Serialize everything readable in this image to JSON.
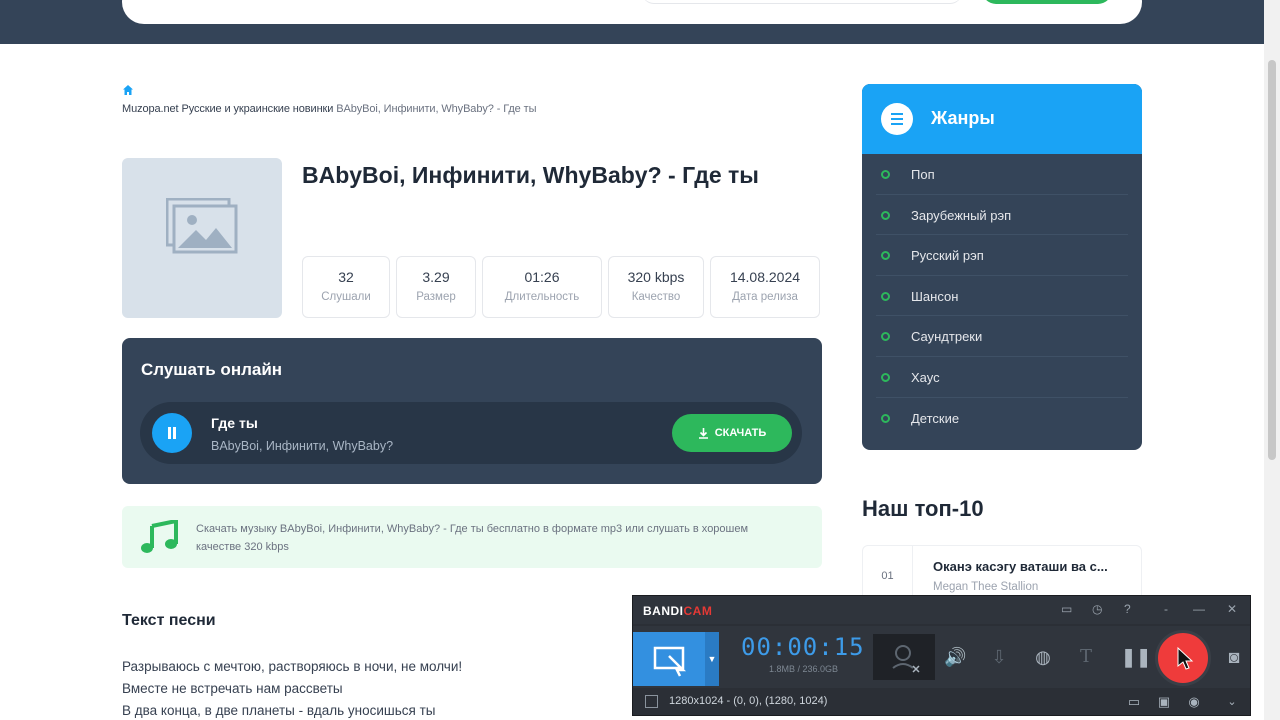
{
  "breadcrumb": {
    "site": "Muzopa.net",
    "category": "Русские и украинские новинки",
    "current": "BAbyBoi, Инфинити, WhyBaby? - Где ты"
  },
  "track": {
    "title": "BAbyBoi, Инфинити, WhyBaby? - Где ты",
    "stats": [
      {
        "value": "32",
        "label": "Слушали"
      },
      {
        "value": "3.29",
        "label": "Размер"
      },
      {
        "value": "01:26",
        "label": "Длительность"
      },
      {
        "value": "320 kbps",
        "label": "Качество"
      },
      {
        "value": "14.08.2024",
        "label": "Дата релиза"
      }
    ]
  },
  "player": {
    "heading": "Слушать онлайн",
    "song": "Где ты",
    "artist": "BAbyBoi, Инфинити, WhyBaby?",
    "download_label": "СКАЧАТЬ"
  },
  "info": {
    "text": "Скачать музыку BAbyBoi, Инфинити, WhyBaby? - Где ты бесплатно в формате mp3 или слушать в хорошем качестве 320 kbps"
  },
  "lyrics": {
    "heading": "Текст песни",
    "lines": [
      "Разрываюсь с мечтою, растворяюсь в ночи, не молчи!",
      "Вместе не встречать нам рассветы",
      "В два конца, в две планеты - вдаль уносишься ты"
    ]
  },
  "sidebar": {
    "genres_title": "Жанры",
    "genres": [
      "Поп",
      "Зарубежный рэп",
      "Русский рэп",
      "Шансон",
      "Саундтреки",
      "Хаус",
      "Детские"
    ],
    "top_title": "Наш топ-10",
    "top_items": [
      {
        "num": "01",
        "title": "Оканэ касэгу ваташи ва с...",
        "artist": "Megan Thee Stallion"
      }
    ]
  },
  "bandicam": {
    "logo_a": "BANDI",
    "logo_b": "CAM",
    "timer": "00:00:15",
    "size": "1.8MB / 236.0GB",
    "resolution": "1280x1024 - (0, 0), (1280, 1024)",
    "title_controls": [
      "▭",
      "◷",
      "?",
      "-",
      "—",
      "✕"
    ]
  },
  "colors": {
    "header": "#344458",
    "accent": "#1aa3f5",
    "green": "#2db85c",
    "record": "#ef3b3b"
  }
}
